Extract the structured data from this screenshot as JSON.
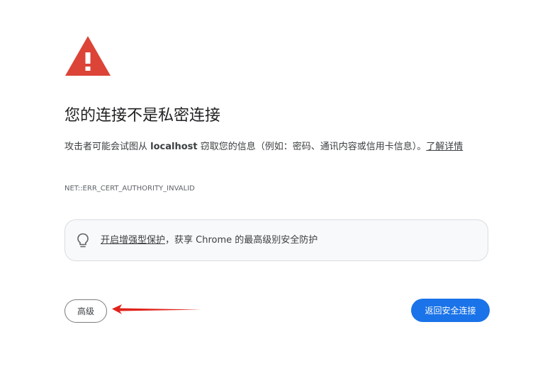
{
  "warning": {
    "icon": "warning-triangle-icon",
    "color": "#db4437"
  },
  "heading": {
    "title": "您的连接不是私密连接"
  },
  "description": {
    "prefix": "攻击者可能会试图从 ",
    "host": "localhost",
    "suffix": " 窃取您的信息（例如：密码、通讯内容或信用卡信息）。",
    "learn_more": "了解详情"
  },
  "error_code": "NET::ERR_CERT_AUTHORITY_INVALID",
  "tip": {
    "icon": "lightbulb-icon",
    "link_text": "开启增强型保护",
    "rest_text": "，获享 Chrome 的最高级别安全防护"
  },
  "buttons": {
    "advanced_label": "高级",
    "back_label": "返回安全连接",
    "back_color": "#1a73e8"
  },
  "annotation": {
    "icon": "red-arrow-icon",
    "color": "#e0231b"
  }
}
